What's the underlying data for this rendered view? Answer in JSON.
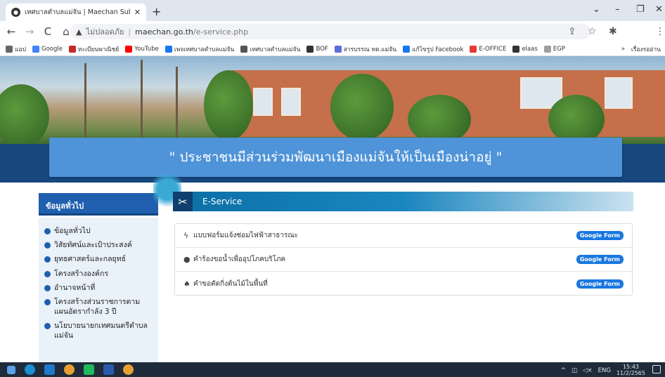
{
  "browser": {
    "tab_title": "เทศบาลตำบลแม่จัน | Maechan Subd",
    "tab_close": "✕",
    "new_tab": "+",
    "address": {
      "security_label": "ไม่ปลอดภัย",
      "domain": "maechan.go.th",
      "path": "/e-service.php"
    },
    "bookmarks": [
      {
        "label": "แอป",
        "color": "#666666"
      },
      {
        "label": "Google",
        "color": "#4285f4"
      },
      {
        "label": "ทะเบียนพาณิชย์",
        "color": "#c62828"
      },
      {
        "label": "YouTube",
        "color": "#ff0000"
      },
      {
        "label": "เพจเทศบาลตำบลแม่จัน",
        "color": "#1877f2"
      },
      {
        "label": "เทศบาลตำบลแม่จัน",
        "color": "#555555"
      },
      {
        "label": "BOF",
        "color": "#333333"
      },
      {
        "label": "สารบรรณ ทต.แม่จัน",
        "color": "#5a6fd8"
      },
      {
        "label": "แก้ไขรูป Facebook",
        "color": "#1877f2"
      },
      {
        "label": "E-OFFICE",
        "color": "#e53935"
      },
      {
        "label": "elaas",
        "color": "#333333"
      },
      {
        "label": "EGP",
        "color": "#9e9e9e"
      }
    ],
    "bookmarks_more": "»",
    "reading_list": "เรื่องรออ่าน"
  },
  "site": {
    "slogan": "\" ประชาชนมีส่วนร่วมพัฒนาเมืองแม่จันให้เป็นเมืองน่าอยู่ \"",
    "sidebar": {
      "heading": "ข้อมูลทั่วไป",
      "items": [
        "ข้อมูลทั่วไป",
        "วิสัยทัศน์และเป้าประสงค์",
        "ยุทธศาสตร์และกลยุทธ์",
        "โครงสร้างองค์กร",
        "อำนาจหน้าที่",
        "โครงสร้างส่วนราชการตามแผนอัตรากำลัง 3 ปี",
        "นโยบายนายกเทศมนตรีตำบลแม่จัน"
      ]
    },
    "eservice": {
      "title": "E-Service",
      "button_label": "Google Form",
      "rows": [
        {
          "icon": "bolt-icon",
          "label": "แบบฟอร์มแจ้งซ่อมไฟฟ้าสาธารณะ"
        },
        {
          "icon": "water-drop-icon",
          "label": "คำร้องขอน้ำเพื่ออุปโภคบริโภค"
        },
        {
          "icon": "tree-icon",
          "label": "คำขอตัดกิ่งต้นไม้ในพื้นที่"
        }
      ]
    }
  },
  "taskbar": {
    "lang": "ENG",
    "time": "15:43",
    "date": "11/2/2565"
  }
}
